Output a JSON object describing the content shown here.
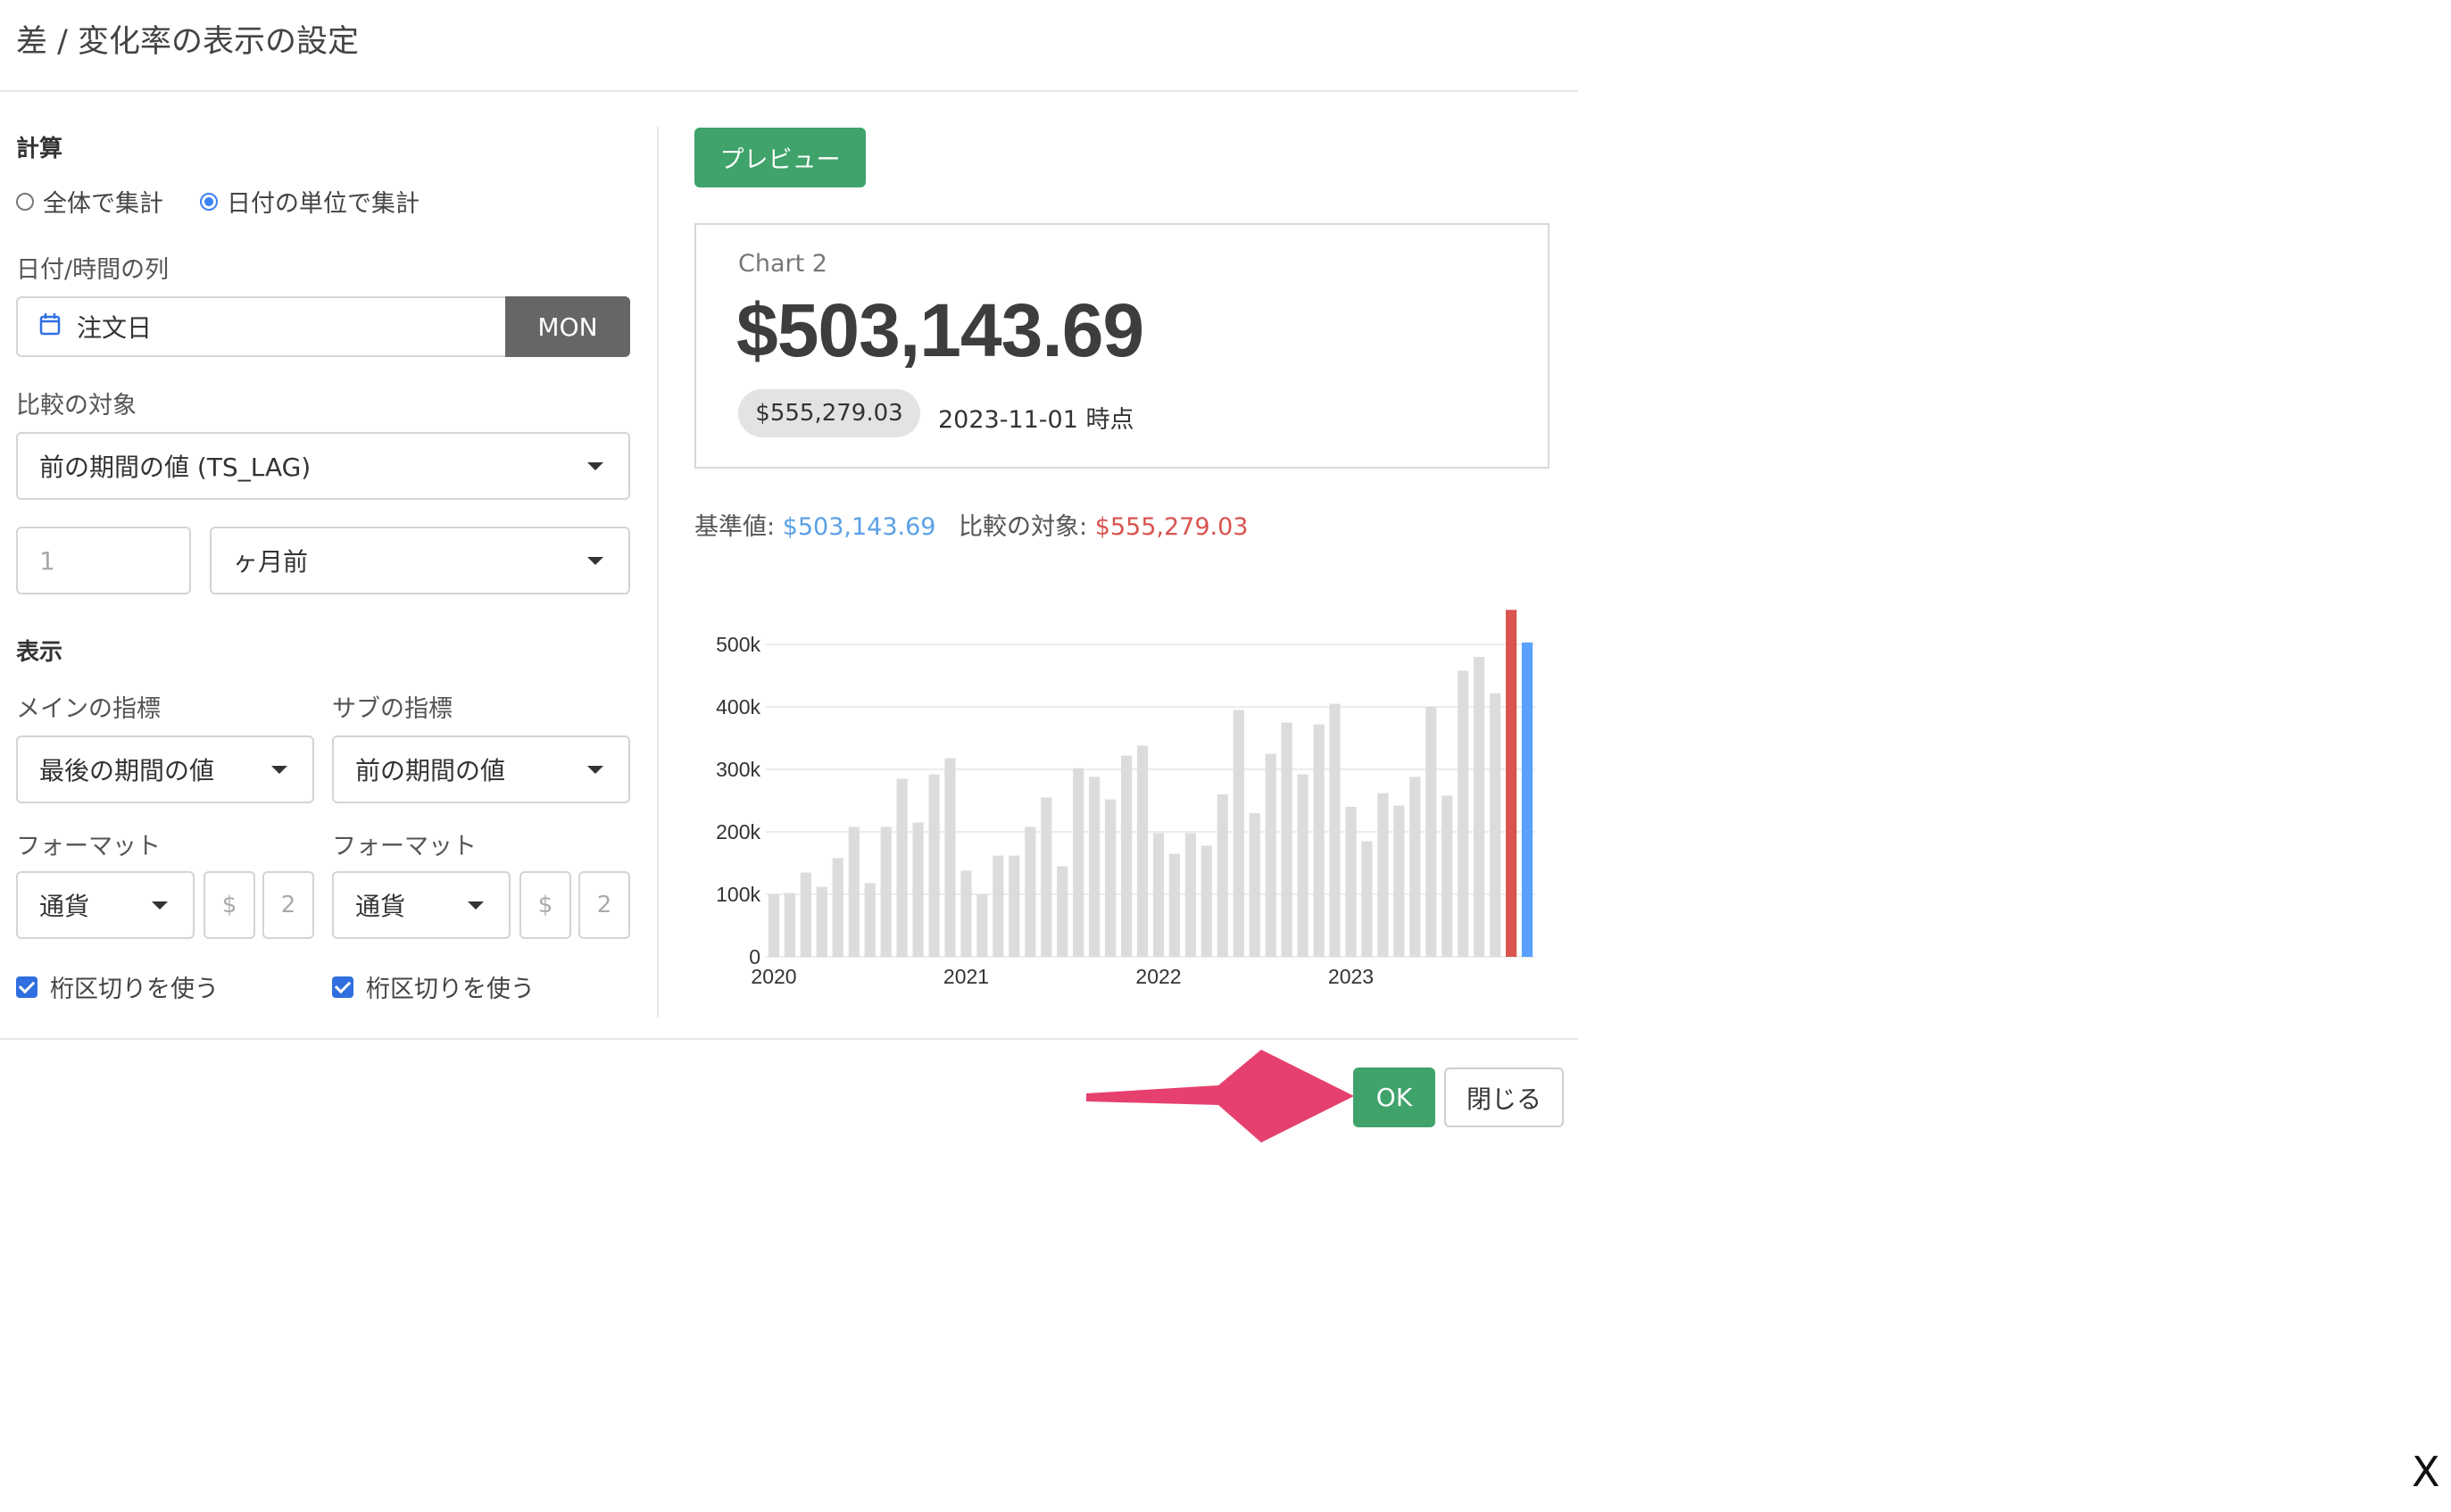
{
  "dialog": {
    "title": "差 / 変化率の表示の設定"
  },
  "calc": {
    "section": "計算",
    "radio_all": "全体で集計",
    "radio_date": "日付の単位で集計",
    "selected": "date",
    "date_col_label": "日付/時間の列",
    "date_col_value": "注文日",
    "date_unit": "MON",
    "compare_label": "比較の対象",
    "compare_value": "前の期間の値 (TS_LAG)",
    "lag_placeholder": "1",
    "lag_unit": "ヶ月前"
  },
  "display": {
    "section": "表示",
    "main_label": "メインの指標",
    "main_value": "最後の期間の値",
    "sub_label": "サブの指標",
    "sub_value": "前の期間の値",
    "main_format_label": "フォーマット",
    "main_format_value": "通貨",
    "main_symbol": "$",
    "main_digits": "2",
    "sub_format_label": "フォーマット",
    "sub_format_value": "通貨",
    "sub_symbol": "$",
    "sub_digits": "2",
    "main_separator_label": "桁区切りを使う",
    "sub_separator_label": "桁区切りを使う",
    "main_separator_checked": true,
    "sub_separator_checked": true
  },
  "preview": {
    "button": "プレビュー",
    "card_title": "Chart 2",
    "big_value": "$503,143.69",
    "sub_value": "$555,279.03",
    "as_of": "2023-11-01 時点",
    "base_label": "基準値: ",
    "base_value": "$503,143.69",
    "compare_label": "比較の対象: ",
    "compare_value": "$555,279.03"
  },
  "footer": {
    "ok": "OK",
    "close": "閉じる"
  },
  "corner_close": "X",
  "colors": {
    "green": "#3fa36b",
    "blue_value": "#5aa0e6",
    "red_value": "#d9534f",
    "bar_gray": "#dcdcdc",
    "bar_red": "#d9534f",
    "bar_blue": "#5aa0ff",
    "arrow": "#e6406e"
  },
  "chart_data": {
    "type": "bar",
    "x_ticks": [
      "2020",
      "2021",
      "2022",
      "2023"
    ],
    "y_ticks": [
      "0",
      "100k",
      "200k",
      "300k",
      "400k",
      "500k"
    ],
    "ylim": [
      0,
      560000
    ],
    "first_period": "2020-01",
    "series": [
      {
        "values": [
          100000,
          102000,
          135000,
          112000,
          158000,
          208000,
          118000,
          208000,
          285000,
          215000,
          292000,
          318000,
          138000,
          100000,
          162000,
          162000,
          208000,
          255000,
          145000,
          302000,
          288000,
          252000,
          322000,
          338000,
          198000,
          165000,
          198000,
          178000,
          260000,
          395000,
          230000,
          325000,
          375000,
          292000,
          372000,
          405000,
          240000,
          185000,
          262000,
          242000,
          288000,
          400000,
          258000,
          458000,
          480000,
          422000
        ]
      },
      {
        "values": [
          555279.03
        ]
      },
      {
        "values": [
          503143.69
        ]
      }
    ]
  }
}
